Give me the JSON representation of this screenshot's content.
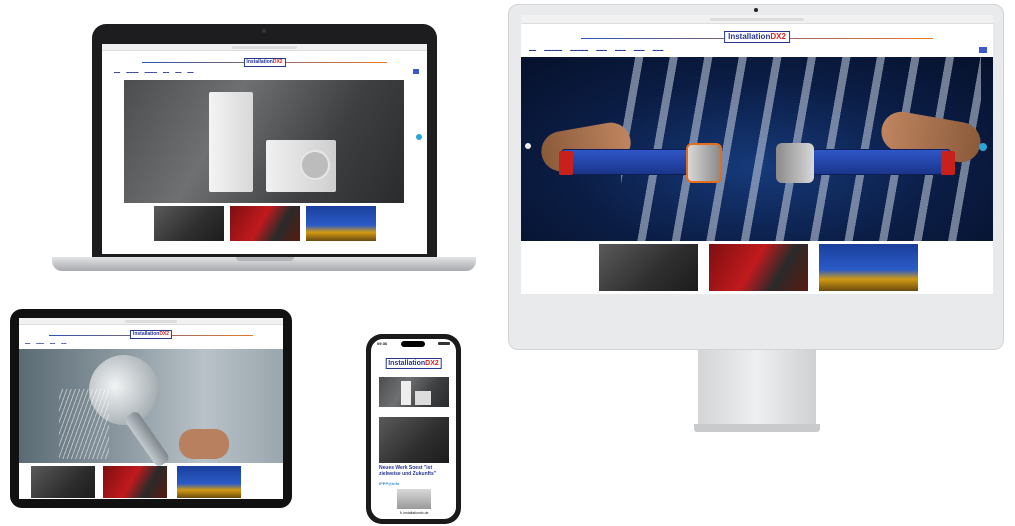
{
  "site": {
    "logo_main": "Installation",
    "logo_accent": "DX2",
    "accent_blue": "#27368f",
    "accent_red": "#d8231d"
  },
  "devices": {
    "laptop": {
      "hero": "heat-pump",
      "thumbnails": [
        "valve-product",
        "red-machine",
        "blue-yellow-pump"
      ]
    },
    "imac": {
      "hero": "press-tools-pipes",
      "thumbnails": [
        "valve-product",
        "red-machine",
        "blue-yellow-pump"
      ]
    },
    "tablet": {
      "hero": "shower-head",
      "thumbnails": [
        "valve-product",
        "red-machine",
        "blue-yellow-pump"
      ]
    },
    "phone": {
      "time": "09:36",
      "article_title": "Neues Werk Soest \"ist zielweise und Zukunfts\"",
      "article_link": "IPPP@info",
      "footer_url": "↻ installationdx.de",
      "thumbnails": [
        "heat-pump",
        "valve-product",
        "heat-pump-small"
      ]
    }
  },
  "icons": [
    "nav-left-arrow-icon",
    "nav-right-arrow-icon",
    "search-icon",
    "camera-dot-icon"
  ]
}
